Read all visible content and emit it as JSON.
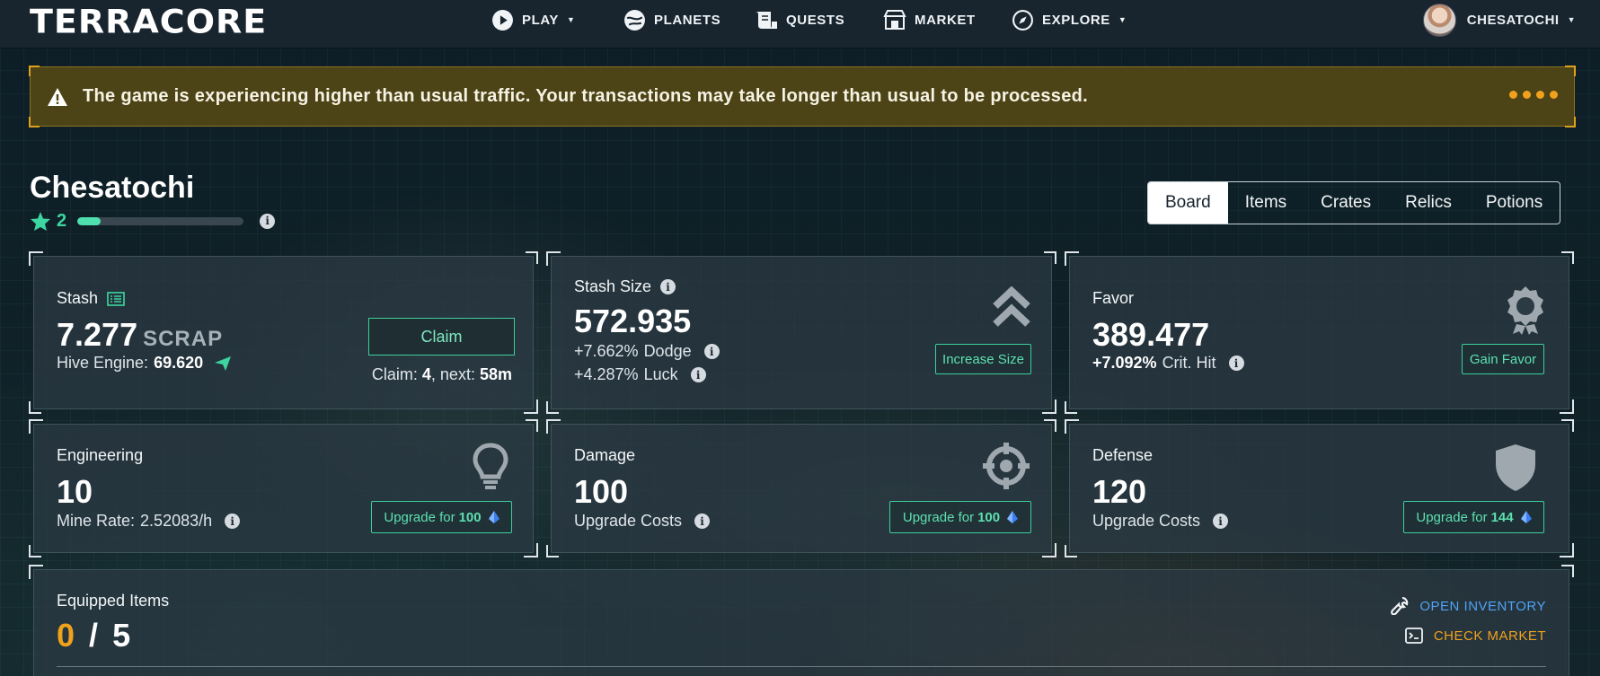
{
  "nav": {
    "logo": "TERRACORE",
    "items": [
      {
        "label": "PLAY",
        "icon": "play-icon",
        "has_caret": true
      },
      {
        "label": "PLANETS",
        "icon": "planet-icon"
      },
      {
        "label": "QUESTS",
        "icon": "scroll-icon"
      },
      {
        "label": "MARKET",
        "icon": "store-icon"
      },
      {
        "label": "EXPLORE",
        "icon": "compass-icon",
        "has_caret": true
      }
    ],
    "user": "CHESATOCHI"
  },
  "banner": {
    "message": "The game is experiencing higher than usual traffic. Your transactions may take longer than usual to be processed.",
    "icon": "warning-icon",
    "color": "#f0a21d"
  },
  "profile": {
    "name": "Chesatochi",
    "level": "2",
    "xp_fraction": 0.14
  },
  "tabs": [
    "Board",
    "Items",
    "Crates",
    "Relics",
    "Potions"
  ],
  "cards": {
    "stash": {
      "title": "Stash",
      "value": "7.277",
      "unit": "SCRAP",
      "hive_label": "Hive Engine:",
      "hive_value": "69.620",
      "claim_button": "Claim",
      "claim_label": "Claim:",
      "claim_count": "4",
      "next_label": ", next:",
      "next_value": "58m"
    },
    "stash_size": {
      "title": "Stash Size",
      "value": "572.935",
      "dodge_value": "+7.662%",
      "dodge_label": "Dodge",
      "luck_value": "+4.287%",
      "luck_label": "Luck",
      "button": "Increase Size"
    },
    "favor": {
      "title": "Favor",
      "value": "389.477",
      "crit_value": "+7.092%",
      "crit_label": "Crit. Hit",
      "button": "Gain Favor"
    },
    "engineering": {
      "title": "Engineering",
      "value": "10",
      "mine_label": "Mine Rate:",
      "mine_value": "2.52083/h",
      "button_label": "Upgrade for",
      "button_cost": "100"
    },
    "damage": {
      "title": "Damage",
      "value": "100",
      "sub": "Upgrade Costs",
      "button_label": "Upgrade for",
      "button_cost": "100"
    },
    "defense": {
      "title": "Defense",
      "value": "120",
      "sub": "Upgrade Costs",
      "button_label": "Upgrade for",
      "button_cost": "144"
    }
  },
  "equipped": {
    "title": "Equipped Items",
    "count": "0",
    "separator": "/",
    "max": "5",
    "open_inventory": "OPEN INVENTORY",
    "check_market": "CHECK MARKET"
  },
  "colors": {
    "accent": "#3ccf9a",
    "warning": "#f0a21d",
    "link_blue": "#4fa3f7",
    "link_orange": "#f0a21d"
  }
}
